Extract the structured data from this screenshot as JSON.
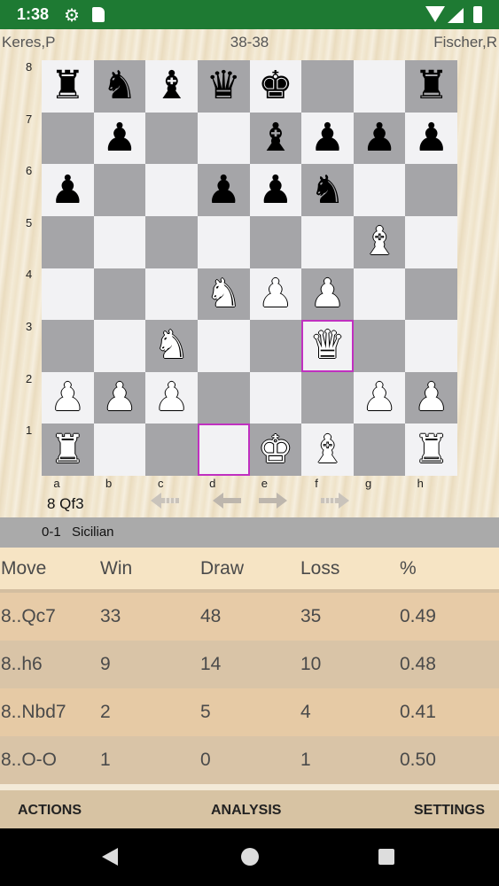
{
  "status": {
    "time": "1:38",
    "icons": [
      "gear-icon",
      "sd-card-icon",
      "wifi-icon",
      "signal-icon",
      "battery-icon"
    ],
    "bar_color": "#1e7a33"
  },
  "game": {
    "white_player": "Keres,P",
    "black_player": "Fischer,R",
    "score": "38-38",
    "last_move": "8 Qf3",
    "result": "0-1",
    "opening": "Sicilian"
  },
  "board": {
    "light_color": "#f2f2f4",
    "dark_color": "#a5a5a8",
    "highlight_color": "#c030c0",
    "highlighted_squares": [
      "f3",
      "d1"
    ],
    "ranks": [
      "8",
      "7",
      "6",
      "5",
      "4",
      "3",
      "2",
      "1"
    ],
    "files": [
      "a",
      "b",
      "c",
      "d",
      "e",
      "f",
      "g",
      "h"
    ],
    "position": [
      [
        "bR",
        "bN",
        "bB",
        "bQ",
        "bK",
        "",
        "",
        "bR"
      ],
      [
        "",
        "bP",
        "",
        "",
        "bB",
        "bP",
        "bP",
        "bP"
      ],
      [
        "bP",
        "",
        "",
        "bP",
        "bP",
        "bN",
        "",
        ""
      ],
      [
        "",
        "",
        "",
        "",
        "",
        "",
        "wB",
        ""
      ],
      [
        "",
        "",
        "",
        "wN",
        "wP",
        "wP",
        "",
        ""
      ],
      [
        "",
        "",
        "wN",
        "",
        "",
        "wQ",
        "",
        ""
      ],
      [
        "wP",
        "wP",
        "wP",
        "",
        "",
        "",
        "wP",
        "wP"
      ],
      [
        "wR",
        "",
        "",
        "",
        "wK",
        "wB",
        "",
        "wR"
      ]
    ]
  },
  "nav_arrows": [
    "first-move-icon",
    "back-arrow-icon",
    "forward-arrow-icon",
    "last-move-icon"
  ],
  "book_table": {
    "headers": [
      "Move",
      "Win",
      "Draw",
      "Loss",
      "%"
    ],
    "rows": [
      [
        "8..Qc7",
        "33",
        "48",
        "35",
        "0.49"
      ],
      [
        "8..h6",
        "9",
        "14",
        "10",
        "0.48"
      ],
      [
        "8..Nbd7",
        "2",
        "5",
        "4",
        "0.41"
      ],
      [
        "8..O-O",
        "1",
        "0",
        "1",
        "0.50"
      ]
    ]
  },
  "actions": {
    "actions_label": "ACTIONS",
    "analysis_label": "ANALYSIS",
    "settings_label": "SETTINGS"
  }
}
